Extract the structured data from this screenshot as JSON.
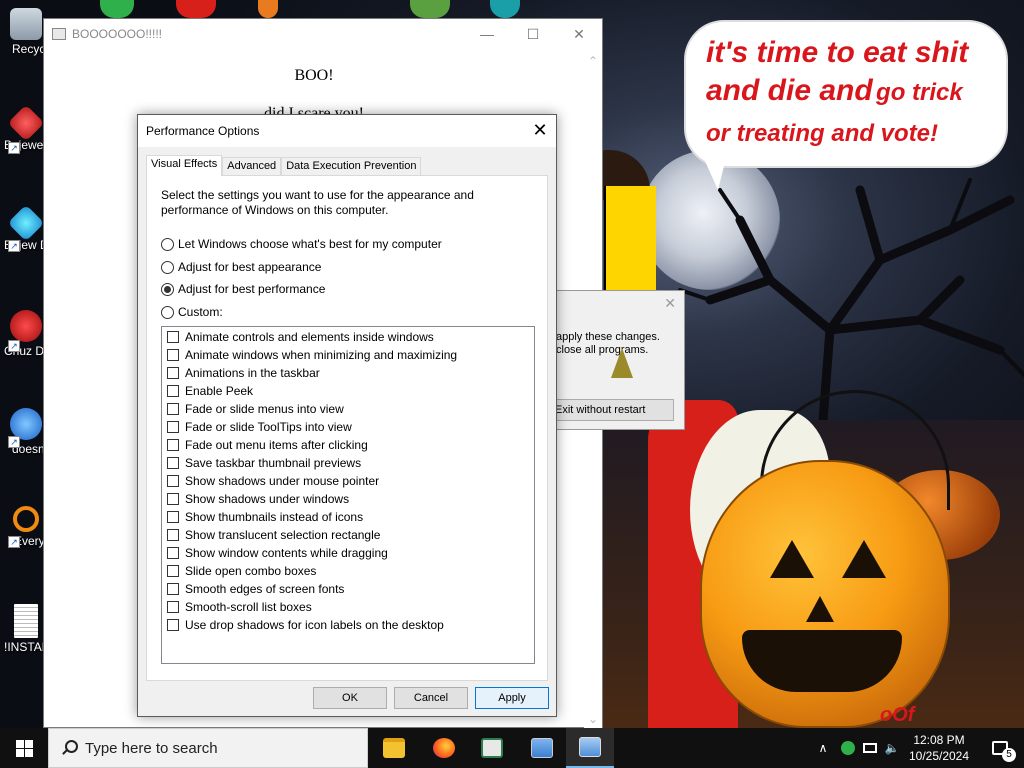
{
  "desktop": {
    "icons": [
      {
        "label": "Recycl",
        "icon": "recycle-bin-icon"
      },
      {
        "label": "Bejewe Delu",
        "icon": "bejeweled-icon"
      },
      {
        "label": "Bejew Delu",
        "icon": "bejeweled-diamond-icon"
      },
      {
        "label": "Chuz Delu",
        "icon": "chuzzle-icon"
      },
      {
        "label": "doesnt",
        "icon": "bird-icon"
      },
      {
        "label": "Everyt",
        "icon": "everything-search-icon"
      },
      {
        "label": "!INSTAL",
        "icon": "text-file-icon"
      }
    ],
    "wallpaper_caption": {
      "line1": "it's time to eat shit",
      "line2a": "and die and",
      "line2b": "go trick",
      "line3": "or treating and vote!"
    },
    "watermark": "oOf"
  },
  "boo_window": {
    "title": "BOOOOOOO!!!!!",
    "heading": "BOO!",
    "line2": "did I scare you!",
    "caption_buttons": {
      "minimize": "—",
      "maximize": "☐",
      "close": "✕"
    },
    "scroll_up": "⌃",
    "scroll_down": "⌄"
  },
  "restart_box": {
    "close": "✕",
    "message_line1": "apply these changes.",
    "message_line2": "close all programs.",
    "exit_button": "Exit without restart"
  },
  "performance_options": {
    "title": "Performance Options",
    "close": "✕",
    "tabs": [
      "Visual Effects",
      "Advanced",
      "Data Execution Prevention"
    ],
    "active_tab": "Visual Effects",
    "description": "Select the settings you want to use for the appearance and performance of Windows on this computer.",
    "radio_options": [
      {
        "label": "Let Windows choose what's best for my computer",
        "checked": false
      },
      {
        "label": "Adjust for best appearance",
        "checked": false
      },
      {
        "label": "Adjust for best performance",
        "checked": true
      },
      {
        "label": "Custom:",
        "checked": false
      }
    ],
    "effects": [
      {
        "label": "Animate controls and elements inside windows",
        "checked": false
      },
      {
        "label": "Animate windows when minimizing and maximizing",
        "checked": false
      },
      {
        "label": "Animations in the taskbar",
        "checked": false
      },
      {
        "label": "Enable Peek",
        "checked": false
      },
      {
        "label": "Fade or slide menus into view",
        "checked": false
      },
      {
        "label": "Fade or slide ToolTips into view",
        "checked": false
      },
      {
        "label": "Fade out menu items after clicking",
        "checked": false
      },
      {
        "label": "Save taskbar thumbnail previews",
        "checked": false
      },
      {
        "label": "Show shadows under mouse pointer",
        "checked": false
      },
      {
        "label": "Show shadows under windows",
        "checked": false
      },
      {
        "label": "Show thumbnails instead of icons",
        "checked": false
      },
      {
        "label": "Show translucent selection rectangle",
        "checked": false
      },
      {
        "label": "Show window contents while dragging",
        "checked": false
      },
      {
        "label": "Slide open combo boxes",
        "checked": false
      },
      {
        "label": "Smooth edges of screen fonts",
        "checked": false
      },
      {
        "label": "Smooth-scroll list boxes",
        "checked": false
      },
      {
        "label": "Use drop shadows for icon labels on the desktop",
        "checked": false
      }
    ],
    "buttons": {
      "ok": "OK",
      "cancel": "Cancel",
      "apply": "Apply"
    }
  },
  "taskbar": {
    "search_placeholder": "Type here to search",
    "apps": [
      {
        "name": "file-explorer-icon",
        "color": "#f2c230",
        "active": false
      },
      {
        "name": "firefox-icon",
        "color": "#ff7a1a",
        "active": false
      },
      {
        "name": "system-properties-icon",
        "color": "#2e7d4f",
        "active": false
      },
      {
        "name": "control-panel-icon",
        "color": "#3a7fd1",
        "active": false
      },
      {
        "name": "computer-window-icon",
        "color": "#4f8fd8",
        "active": true
      }
    ],
    "tray": {
      "chevron": "∧",
      "volume": "🔈"
    },
    "time": "12:08 PM",
    "date": "10/25/2024",
    "notification_count": "5"
  },
  "colors": {
    "caption_red": "#d8161c",
    "taskbar": "#101010",
    "dialog_bg": "#f0f0f0",
    "accent": "#0078d7"
  }
}
